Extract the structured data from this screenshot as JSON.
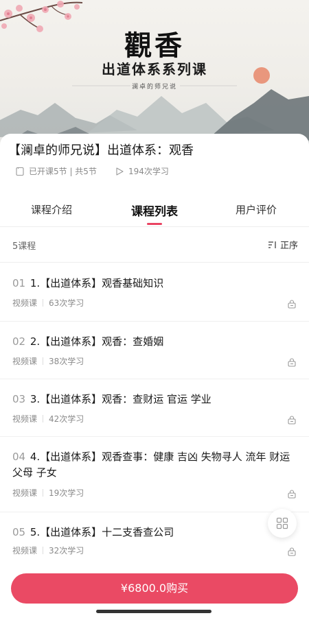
{
  "banner": {
    "title": "觀香",
    "subtitle": "出道体系系列课",
    "signature": "澜卓的师兄说"
  },
  "course": {
    "title": "【澜卓的师兄说】出道体系：观香",
    "lessons_info": "已开课5节 | 共5节",
    "learners": "194次学习"
  },
  "tabs": [
    {
      "label": "课程介绍",
      "active": false
    },
    {
      "label": "课程列表",
      "active": true
    },
    {
      "label": "用户评价",
      "active": false
    }
  ],
  "list": {
    "count_label": "5课程",
    "sort_label": "正序"
  },
  "lessons": [
    {
      "num": "01",
      "title": "1.【出道体系】观香基础知识",
      "type": "视频课",
      "views": "63次学习",
      "locked": true
    },
    {
      "num": "02",
      "title": "2.【出道体系】观香：查婚姻",
      "type": "视频课",
      "views": "38次学习",
      "locked": true
    },
    {
      "num": "03",
      "title": "3.【出道体系】观香：查财运 官运 学业",
      "type": "视频课",
      "views": "42次学习",
      "locked": true
    },
    {
      "num": "04",
      "title": "4.【出道体系】观香查事：健康 吉凶 失物寻人 流年 财运 父母 子女",
      "type": "视频课",
      "views": "19次学习",
      "locked": true
    },
    {
      "num": "05",
      "title": "5.【出道体系】十二支香查公司",
      "type": "视频课",
      "views": "32次学习",
      "locked": true
    }
  ],
  "buy": {
    "label": "¥6800.0购买"
  },
  "colors": {
    "accent": "#ea4a64",
    "text": "#1a1a1a",
    "muted": "#8a8a8a"
  }
}
